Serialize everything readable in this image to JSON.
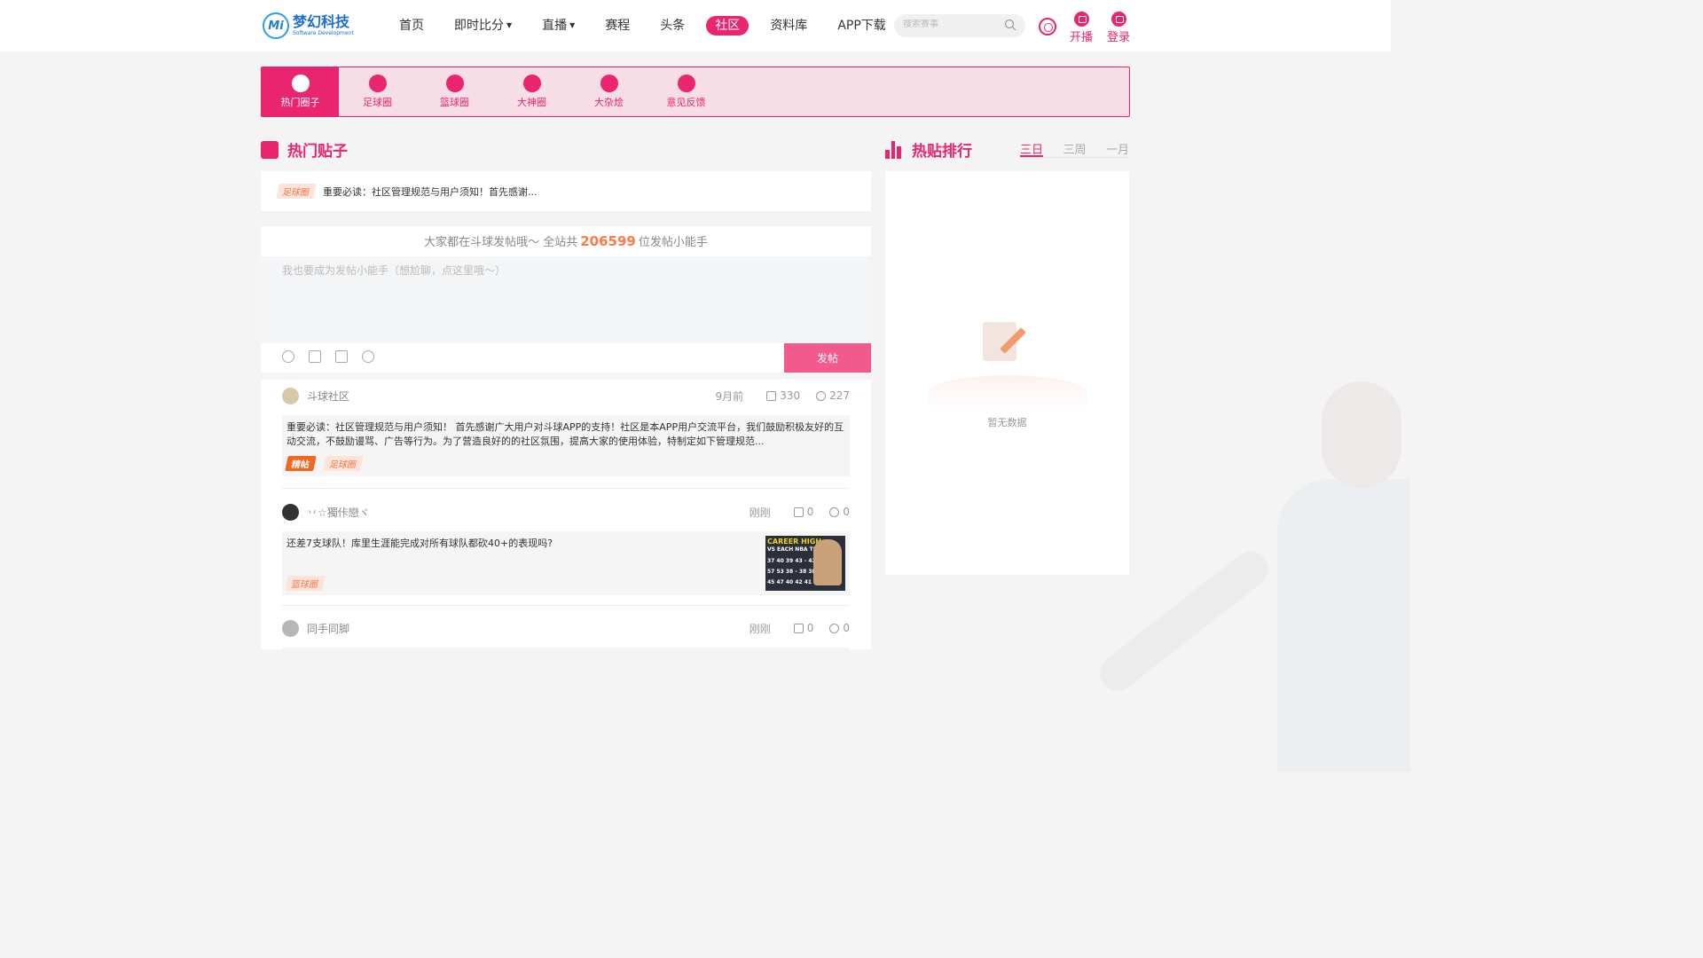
{
  "header": {
    "logo": {
      "mark": "Mi",
      "name": "梦幻科技",
      "subtitle": "Software Development"
    },
    "nav": [
      {
        "label": "首页",
        "dropdown": false,
        "active": false
      },
      {
        "label": "即时比分",
        "dropdown": true,
        "active": false
      },
      {
        "label": "直播",
        "dropdown": true,
        "active": false
      },
      {
        "label": "赛程",
        "dropdown": false,
        "active": false
      },
      {
        "label": "头条",
        "dropdown": false,
        "active": false
      },
      {
        "label": "社区",
        "dropdown": false,
        "active": true
      },
      {
        "label": "资料库",
        "dropdown": false,
        "active": false
      },
      {
        "label": "APP下载",
        "dropdown": false,
        "active": false
      }
    ],
    "search_placeholder": "搜索赛事",
    "broadcast_label": "开播",
    "login_label": "登录"
  },
  "categories": [
    {
      "label": "热门圈子",
      "icon": "play-circle-icon",
      "active": true
    },
    {
      "label": "足球圈",
      "icon": "football-icon",
      "active": false
    },
    {
      "label": "篮球圈",
      "icon": "basketball-icon",
      "active": false
    },
    {
      "label": "大神圈",
      "icon": "expert-icon",
      "active": false
    },
    {
      "label": "大杂烩",
      "icon": "misc-icon",
      "active": false
    },
    {
      "label": "意见反馈",
      "icon": "feedback-icon",
      "active": false
    }
  ],
  "hot_posts": {
    "title": "热门贴子",
    "pinned": {
      "tag": "足球圈",
      "text": "重要必读：社区管理规范与用户须知！首先感谢..."
    }
  },
  "composer": {
    "prefix": "大家都在斗球发帖哦～ 全站共",
    "count": "206599",
    "suffix": "位发帖小能手",
    "placeholder": "我也要成为发帖小能手（想尬聊，点这里哦～）",
    "submit_label": "发帖"
  },
  "posts": [
    {
      "author": "斗球社区",
      "time": "9月前",
      "likes": "330",
      "comments": "227",
      "text": "重要必读：社区管理规范与用户须知！ 首先感谢广大用户对斗球APP的支持！社区是本APP用户交流平台，我们鼓励积极友好的互动交流，不鼓励谩骂、广告等行为。为了营造良好的的社区氛围，提高大家的使用体验，特制定如下管理规范...",
      "tags": [
        "精帖",
        "足球圈"
      ]
    },
    {
      "author": "丷☆獨佧戀ヾ",
      "time": "刚刚",
      "likes": "0",
      "comments": "0",
      "text": "还差7支球队！库里生涯能完成对所有球队都砍40+的表现吗?",
      "tags": [
        "篮球圈"
      ],
      "thumb": {
        "line1": "CAREER HIGH",
        "line2": "VS EACH NBA TEAM",
        "row1": "37 40 39 43 - 42",
        "row2": "57 53 38 - 38 38",
        "row3": "45 47 40 42 41 46"
      }
    },
    {
      "author": "同手同脚",
      "time": "刚刚",
      "likes": "0",
      "comments": "0"
    }
  ],
  "ranking": {
    "title": "热贴排行",
    "tabs": [
      {
        "label": "三日",
        "active": true
      },
      {
        "label": "三周",
        "active": false
      },
      {
        "label": "一月",
        "active": false
      }
    ],
    "empty_text": "暂无数据"
  },
  "colors": {
    "accent": "#e8256e",
    "orange": "#ff7a45",
    "tag_bg": "#fde3d8"
  }
}
